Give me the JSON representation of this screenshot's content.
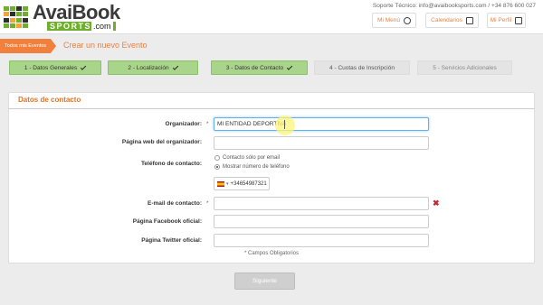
{
  "brand": {
    "name": "AvaiBook",
    "sub": "SPORTS",
    "domain": ".com",
    "accent": "#f0803c",
    "green": "#6fae2e"
  },
  "header": {
    "support": "Soporte Técnico: info@avaibooksports.com / +34 876 600 027",
    "buttons": [
      {
        "label": "Mi Menú",
        "icon": "medal-icon"
      },
      {
        "label": "Calendarios",
        "icon": "calendar-icon"
      },
      {
        "label": "Mi Perfil",
        "icon": "profile-icon"
      }
    ]
  },
  "breadcrumb": {
    "crumb": "Todos mis Eventos",
    "title": "Crear un nuevo Evento"
  },
  "steps": [
    {
      "label": "1 - Datos Generales",
      "done": true
    },
    {
      "label": "2 - Localización",
      "done": true
    },
    {
      "label": "3 - Datos de Contacto",
      "done": true
    },
    {
      "label": "4 - Cuotas de Inscripción",
      "done": false
    },
    {
      "label": "5 - Servicios Adicionales",
      "done": false
    }
  ],
  "form": {
    "section_title": "Datos de contacto",
    "required_mark": "*",
    "organizer": {
      "label": "Organizador:",
      "value": "MI ENTIDAD DEPORTIVA"
    },
    "website": {
      "label": "Página web del organizador:",
      "value": ""
    },
    "phone": {
      "label": "Teléfono de contacto:",
      "option_email": "Contacto sólo por email",
      "option_show": "Mostrar número de teléfono",
      "selected": "show",
      "number": "+34654987321"
    },
    "email": {
      "label": "E-mail de contacto:",
      "value": "",
      "error_icon": "close-icon"
    },
    "facebook": {
      "label": "Página Facebook oficial:",
      "value": ""
    },
    "twitter": {
      "label": "Página Twitter oficial:",
      "value": ""
    },
    "required_hint": "* Campos Obligatorios"
  },
  "actions": {
    "next_label": "Siguiente"
  }
}
